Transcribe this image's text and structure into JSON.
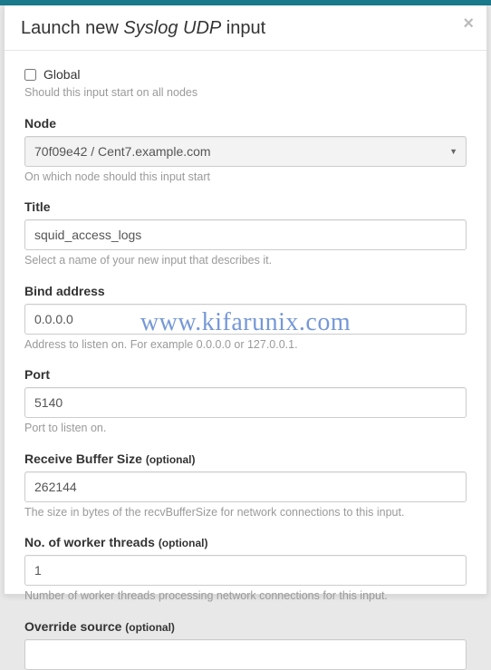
{
  "modal": {
    "title_prefix": "Launch new ",
    "title_em": "Syslog UDP",
    "title_suffix": " input",
    "close_label": "×"
  },
  "form": {
    "global": {
      "label": "Global",
      "checked": false,
      "help": "Should this input start on all nodes"
    },
    "node": {
      "label": "Node",
      "value": "70f09e42 / Cent7.example.com",
      "help": "On which node should this input start"
    },
    "title": {
      "label": "Title",
      "value": "squid_access_logs",
      "help": "Select a name of your new input that describes it."
    },
    "bind_address": {
      "label": "Bind address",
      "value": "0.0.0.0",
      "help": "Address to listen on. For example 0.0.0.0 or 127.0.0.1."
    },
    "port": {
      "label": "Port",
      "value": "5140",
      "help": "Port to listen on."
    },
    "recv_buffer": {
      "label": "Receive Buffer Size",
      "optional": "(optional)",
      "value": "262144",
      "help": "The size in bytes of the recvBufferSize for network connections to this input."
    },
    "worker_threads": {
      "label": "No. of worker threads",
      "optional": "(optional)",
      "value": "1",
      "help": "Number of worker threads processing network connections for this input."
    },
    "override_source": {
      "label": "Override source",
      "optional": "(optional)",
      "value": ""
    }
  },
  "watermark": "www.kifarunix.com"
}
